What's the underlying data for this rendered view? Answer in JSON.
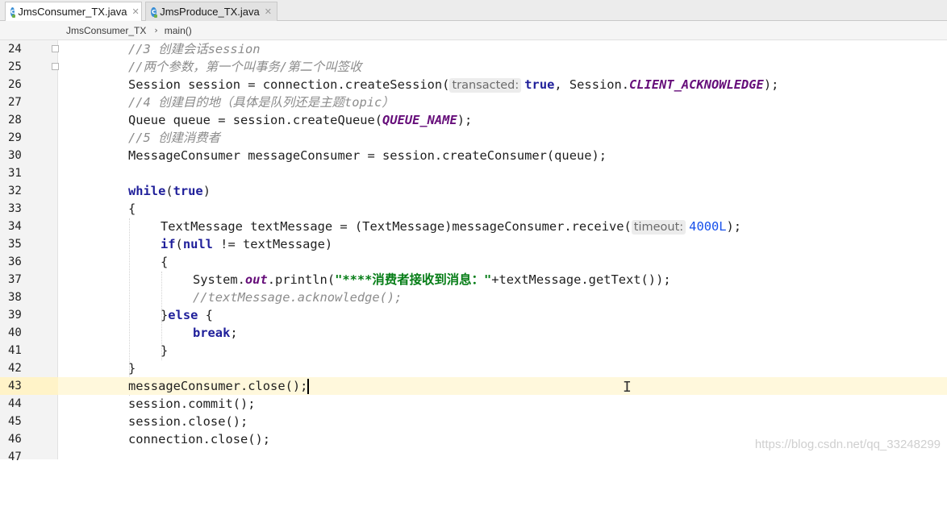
{
  "tabs": [
    {
      "label": "JmsConsumer_TX.java",
      "icon": "java-class-icon",
      "active": true
    },
    {
      "label": "JmsProduce_TX.java",
      "icon": "java-class-icon",
      "active": false
    }
  ],
  "breadcrumb": {
    "class_name": "JmsConsumer_TX",
    "method": "main()"
  },
  "cursor_line": 43,
  "code": {
    "l24": "//3 创建会话session",
    "l25": "//两个参数，第一个叫事务/第二个叫签收",
    "l26": {
      "a": "Session session = connection.createSession(",
      "hint": "transacted:",
      "kw": "true",
      "b": ", Session.",
      "cst": "CLIENT_ACKNOWLEDGE",
      "c": ");"
    },
    "l27": "//4 创建目的地（具体是队列还是主题topic）",
    "l28": {
      "a": "Queue queue = session.createQueue(",
      "cst": "QUEUE_NAME",
      "b": ");"
    },
    "l29": "//5 创建消费者",
    "l30": "MessageConsumer messageConsumer = session.createConsumer(queue);",
    "l31": "",
    "l32": {
      "kw": "while",
      "a": "(",
      "kw2": "true",
      "b": ")"
    },
    "l33": "{",
    "l34": {
      "a": "TextMessage textMessage = (TextMessage)messageConsumer.receive(",
      "hint": "timeout:",
      "num": "4000L",
      "b": ");"
    },
    "l35": {
      "kw": "if",
      "a": "(",
      "kw2": "null",
      "b": " != textMessage)"
    },
    "l36": "{",
    "l37": {
      "a": "System.",
      "out": "out",
      "b": ".println(",
      "str": "\"****消费者接收到消息：\"",
      "c": "+textMessage.getText());"
    },
    "l38": "//textMessage.acknowledge();",
    "l39": {
      "a": "}",
      "kw": "else",
      "b": " {"
    },
    "l40": {
      "kw": "break",
      "a": ";"
    },
    "l41": "}",
    "l42": "}",
    "l43": "messageConsumer.close();",
    "l44": "session.commit();",
    "l45": "session.close();",
    "l46": "connection.close();",
    "l47": ""
  },
  "watermark": "https://blog.csdn.net/qq_33248299",
  "colors": {
    "keyword": "#1f1f9a",
    "comment": "#8c8c8c",
    "constant": "#660e7a",
    "number": "#1750eb",
    "string": "#067d17",
    "current_line": "#fff8dc"
  }
}
